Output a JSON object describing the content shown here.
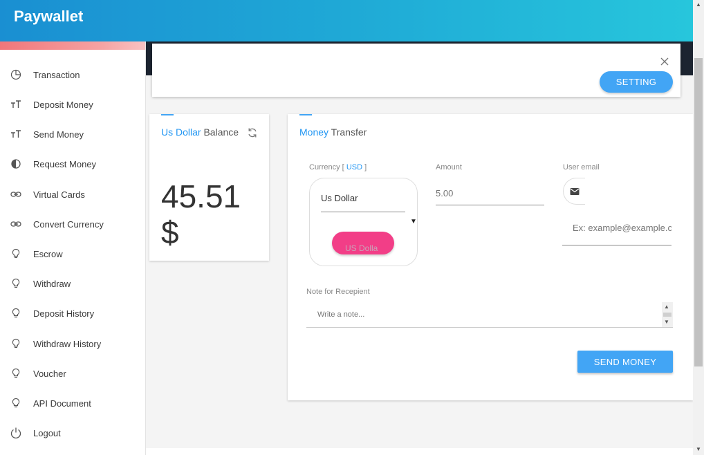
{
  "header": {
    "brand": "Paywallet"
  },
  "sidebar": {
    "items": [
      {
        "label": "Transaction",
        "icon": "pie-chart-icon"
      },
      {
        "label": "Deposit Money",
        "icon": "text-size-icon"
      },
      {
        "label": "Send Money",
        "icon": "text-size-icon"
      },
      {
        "label": "Request Money",
        "icon": "contrast-icon"
      },
      {
        "label": "Virtual Cards",
        "icon": "link-icon"
      },
      {
        "label": "Convert Currency",
        "icon": "link-icon"
      },
      {
        "label": "Escrow",
        "icon": "lightbulb-icon"
      },
      {
        "label": "Withdraw",
        "icon": "lightbulb-icon"
      },
      {
        "label": "Deposit History",
        "icon": "lightbulb-icon"
      },
      {
        "label": "Withdraw History",
        "icon": "lightbulb-icon"
      },
      {
        "label": "Voucher",
        "icon": "lightbulb-icon"
      },
      {
        "label": "API Document",
        "icon": "lightbulb-icon"
      },
      {
        "label": "Logout",
        "icon": "power-icon"
      }
    ]
  },
  "setting_panel": {
    "button_label": "SETTING",
    "close_icon": "close-icon"
  },
  "balance": {
    "title_accent": "Us Dollar",
    "title_rest": "Balance",
    "amount": "45.51",
    "symbol": "$",
    "refresh_icon": "refresh-icon"
  },
  "transfer": {
    "title_accent": "Money",
    "title_rest": "Transfer",
    "currency_label": "Currency [",
    "currency_code": "USD",
    "currency_label_end": "]",
    "currency_selected": "Us Dollar",
    "pill_text": "US Dolla",
    "amount_label": "Amount",
    "amount_placeholder": "5.00",
    "email_label": "User email",
    "email_placeholder": "Ex: example@example.com",
    "note_label": "Note for Recepient",
    "note_placeholder": "Write a note...",
    "send_button": "SEND MONEY"
  },
  "colors": {
    "accent": "#42a5f5",
    "pink": "#f23e87",
    "header_start": "#1a8fd2",
    "header_end": "#27c6dc"
  }
}
